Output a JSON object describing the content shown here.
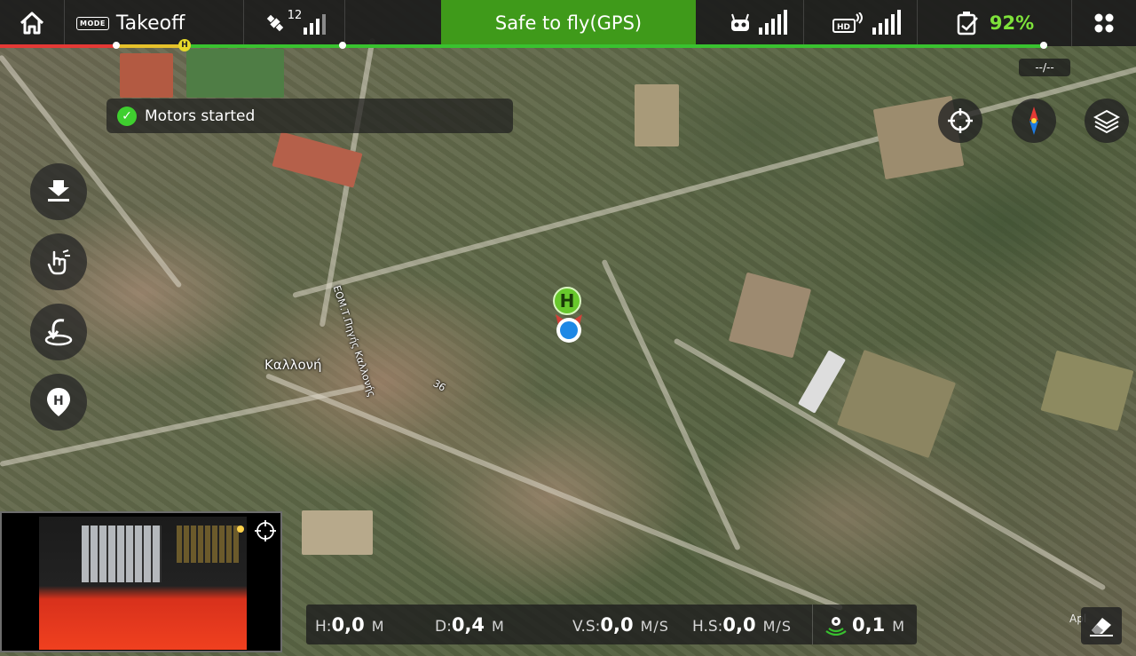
{
  "topbar": {
    "mode_badge": "MODE",
    "mode": "Takeoff",
    "gps_count": "12",
    "status": "Safe to fly(GPS)",
    "battery": "92%"
  },
  "time_label": "--/--",
  "notification": {
    "text": "Motors started"
  },
  "map": {
    "town_label": "Καλλονή",
    "road_label": "ΕΟΜ.Τ.Πηγής Καλλονής",
    "road_number": "36",
    "home_marker": "H",
    "attribution": "Apl"
  },
  "progress": {
    "home_marker": "H"
  },
  "telemetry": {
    "h_label": "H:",
    "h_value": "0,0",
    "h_unit": "M",
    "d_label": "D:",
    "d_value": "0,4",
    "d_unit": "M",
    "vs_label": "V.S:",
    "vs_value": "0,0",
    "vs_unit": "M/S",
    "hs_label": "H.S:",
    "hs_value": "0,0",
    "hs_unit": "M/S",
    "vps_value": "0,1",
    "vps_unit": "M"
  },
  "colors": {
    "status_green": "#3f9a1a",
    "battery_green": "#7ee23a",
    "home_green": "#68c82c"
  },
  "icons": [
    "home-icon",
    "satellite-icon",
    "remote-controller-icon",
    "hd-video-icon",
    "battery-icon",
    "menu-grid-icon",
    "takeoff-icon",
    "hand-gesture-icon",
    "return-home-icon",
    "home-point-icon",
    "locate-icon",
    "compass-icon",
    "map-layers-icon",
    "vision-sensor-icon",
    "eraser-icon",
    "target-icon"
  ]
}
